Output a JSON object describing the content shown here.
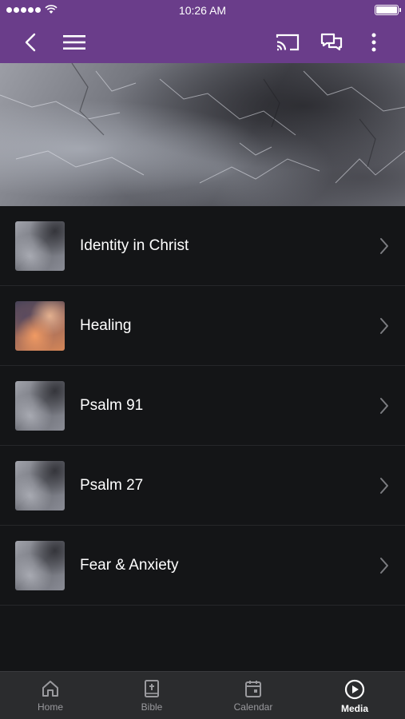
{
  "status_bar": {
    "time": "10:26 AM"
  },
  "nav": {
    "back_icon": "chevron-left-icon",
    "menu_icon": "hamburger-menu-icon",
    "cast_icon": "cast-icon",
    "chat_icon": "chat-bubbles-icon",
    "more_icon": "more-vertical-icon"
  },
  "colors": {
    "header": "#6a3d8a",
    "background": "#141517",
    "tabbar": "#2b2c2e"
  },
  "list": {
    "items": [
      {
        "label": "Identity in Christ",
        "thumb": "stone"
      },
      {
        "label": "Healing",
        "thumb": "sky"
      },
      {
        "label": "Psalm 91",
        "thumb": "stone"
      },
      {
        "label": "Psalm 27",
        "thumb": "stone"
      },
      {
        "label": "Fear & Anxiety",
        "thumb": "stone"
      }
    ]
  },
  "tabs": [
    {
      "label": "Home",
      "icon": "home-icon",
      "active": false
    },
    {
      "label": "Bible",
      "icon": "bible-icon",
      "active": false
    },
    {
      "label": "Calendar",
      "icon": "calendar-icon",
      "active": false
    },
    {
      "label": "Media",
      "icon": "play-circle-icon",
      "active": true
    }
  ]
}
